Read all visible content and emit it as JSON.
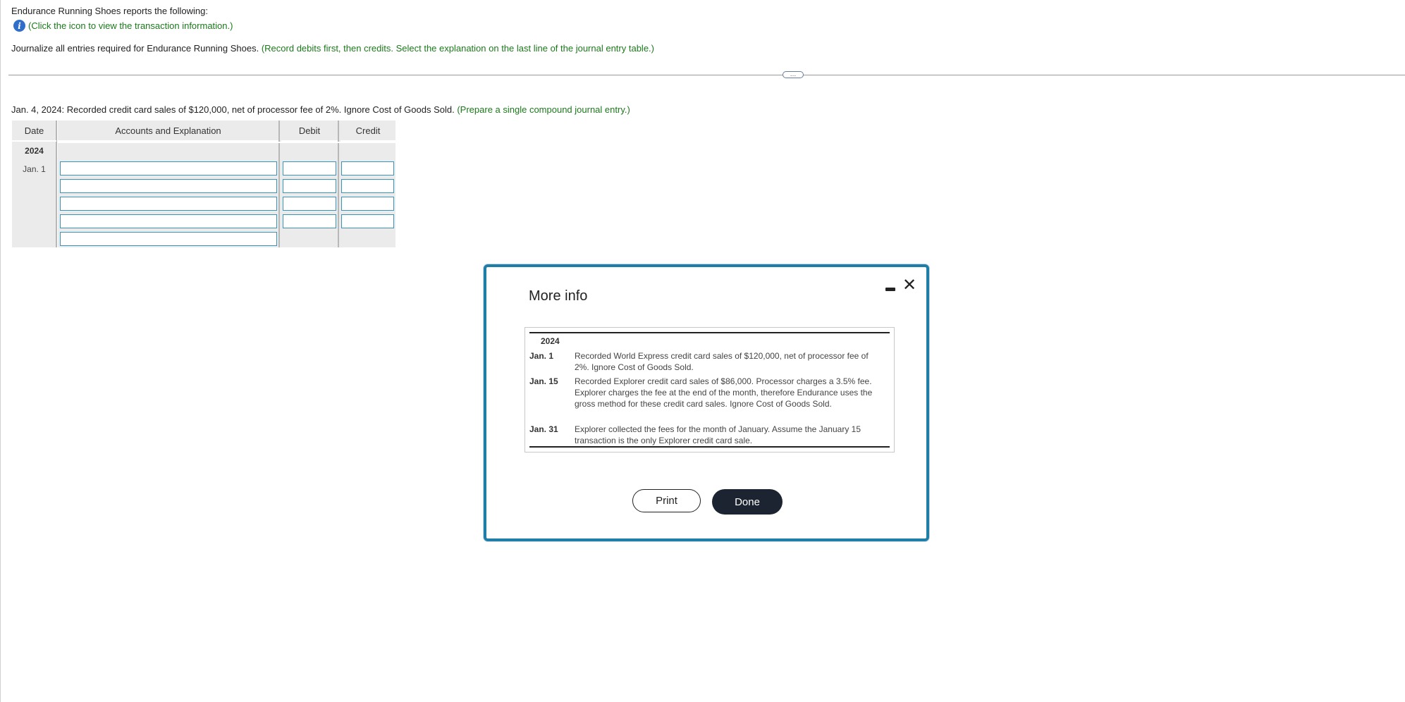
{
  "header": {
    "intro": "Endurance Running Shoes reports the following:",
    "info_link": "(Click the icon to view the transaction information.)",
    "instruction": "Journalize all entries required for Endurance Running Shoes.",
    "instruction_hint": "(Record debits first, then credits. Select the explanation on the last line of the journal entry table.)"
  },
  "expander_label": "…",
  "question": {
    "text": "Jan. 4, 2024: Recorded credit card sales of $120,000, net of processor fee of 2%. Ignore Cost of Goods Sold.",
    "hint": "(Prepare a single compound journal entry.)"
  },
  "journal": {
    "headers": {
      "date": "Date",
      "accounts": "Accounts and Explanation",
      "debit": "Debit",
      "credit": "Credit"
    },
    "year": "2024",
    "date": "Jan. 1",
    "rows": [
      {
        "account": "",
        "debit": "",
        "credit": ""
      },
      {
        "account": "",
        "debit": "",
        "credit": ""
      },
      {
        "account": "",
        "debit": "",
        "credit": ""
      },
      {
        "account": "",
        "debit": "",
        "credit": ""
      }
    ],
    "explanation": ""
  },
  "modal": {
    "title": "More info",
    "year": "2024",
    "entries": [
      {
        "date": "Jan. 1",
        "text": "Recorded World Express credit card sales of $120,000, net of processor fee of 2%. Ignore Cost of Goods Sold."
      },
      {
        "date": "Jan. 15",
        "text": "Recorded Explorer credit card sales of $86,000. Processor charges a 3.5% fee. Explorer charges the fee at the end of the month, therefore Endurance uses the gross method for these credit card sales. Ignore Cost of Goods Sold."
      },
      {
        "date": "Jan. 31",
        "text": "Explorer collected the fees for the month of January. Assume the January 15 transaction is the only Explorer credit card sale."
      }
    ],
    "print_label": "Print",
    "done_label": "Done",
    "close_glyph": "✕"
  }
}
